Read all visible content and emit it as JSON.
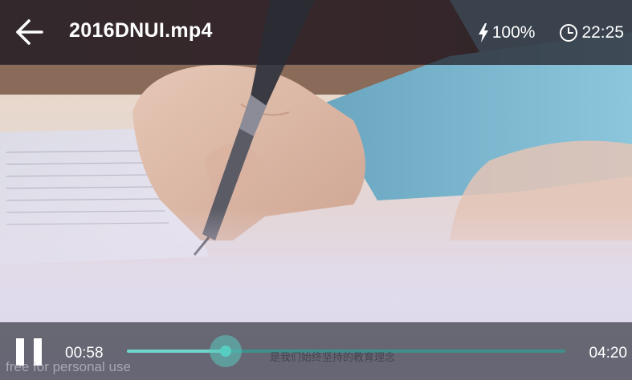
{
  "header": {
    "back_icon": "arrow-left-icon",
    "title": "2016DNUI.mp4",
    "battery_icon": "lightning-bolt-icon",
    "battery": "100%",
    "clock_icon": "clock-icon",
    "time": "22:25"
  },
  "controls": {
    "pause_icon": "pause-icon",
    "elapsed": "00:58",
    "duration": "04:20",
    "progress": 0.225,
    "subtitle": "是我们始终坚持的教育理念"
  },
  "watermark": "free for personal use",
  "colors": {
    "accent": "#6fd6cd",
    "accent_dark": "#3f8f8c",
    "top_bar": "#28282f",
    "bottom_bar": "#464652",
    "sleeve": "#7ab4cc"
  }
}
